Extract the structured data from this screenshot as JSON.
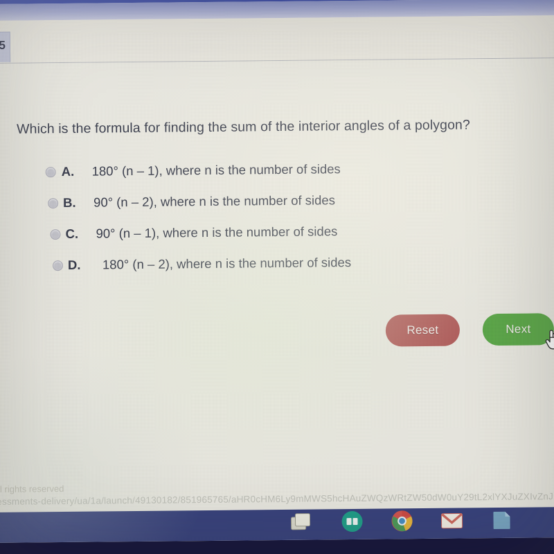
{
  "header": {
    "question_number": "5"
  },
  "question": {
    "text": "Which is the formula for finding the sum of the interior angles of a polygon?"
  },
  "options": [
    {
      "letter": "A.",
      "text": "180° (n – 1), where n is the number of sides",
      "selected": false
    },
    {
      "letter": "B.",
      "text": "90° (n – 2), where n is the number of sides",
      "selected": false
    },
    {
      "letter": "C.",
      "text": "90° (n – 1), where n is the number of sides",
      "selected": false
    },
    {
      "letter": "D.",
      "text": "180° (n – 2), where n is the number of sides",
      "selected": false
    }
  ],
  "buttons": {
    "reset_label": "Reset",
    "next_label": "Next",
    "reset_color": "#b4615f",
    "next_color": "#5faa4c"
  },
  "footer": {
    "copyright": "ll rights reserved",
    "url": "essments-delivery/ua/1a/launch/49130182/851965765/aHR0cHM6Ly9mMWS5hcHAuZWQzWRtZW50dW0uY29tL2xlYXJuZXIvZnJ"
  },
  "taskbar": {
    "icons": [
      "files-icon",
      "teal-app-icon",
      "chrome-icon",
      "gmail-icon",
      "document-icon"
    ],
    "background_color": "#39437e"
  },
  "cursor": {
    "type": "pointer-hand"
  },
  "colors": {
    "top_bar": "#3b4ba8",
    "page_background": "#ecebe3",
    "text": "#2f3344"
  }
}
